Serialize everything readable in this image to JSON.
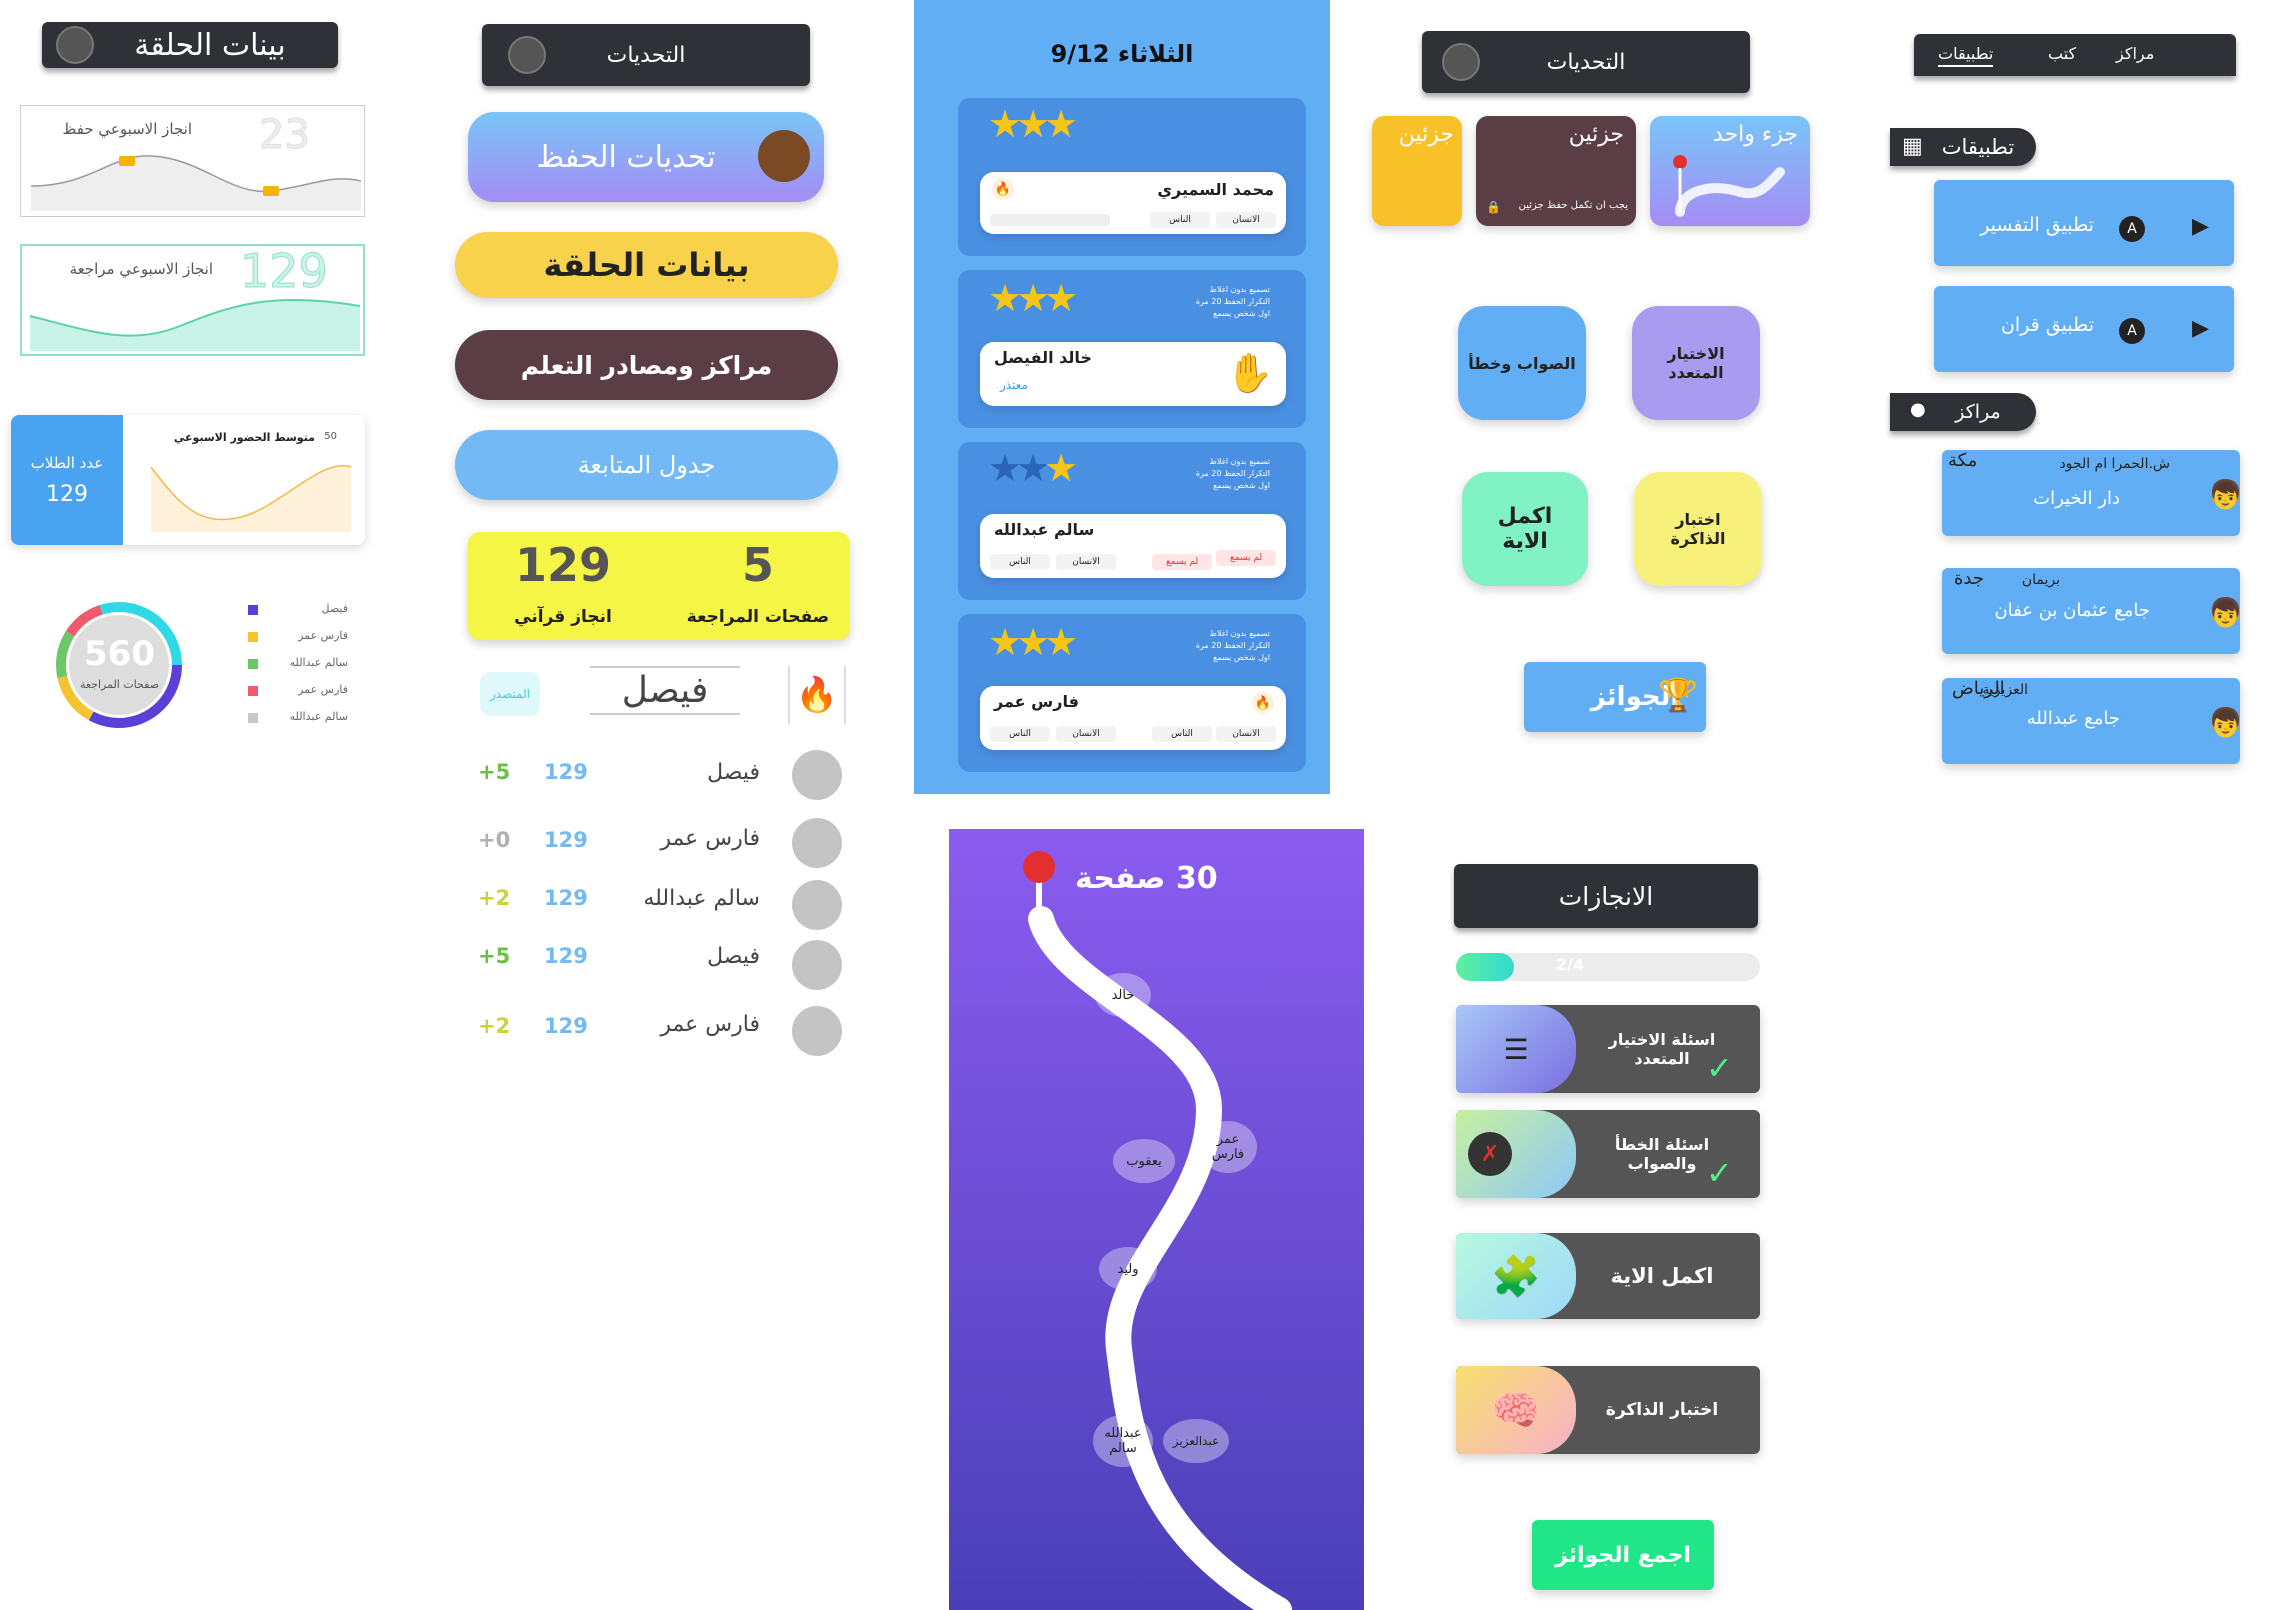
{
  "col1": {
    "title": "بينات الحلقة",
    "weekly_memo_label": "انجاز الاسبوعي حفظ",
    "weekly_memo_value": "23",
    "weekly_review_label": "انجاز الاسبوعي مراجعة",
    "weekly_review_value": "129",
    "attendance_title": "متوسط الحضور الاسبوعي",
    "attendance_max": "50",
    "students_label": "عدد الطلاب",
    "students_value": "129",
    "donut_value": "560",
    "donut_label": "صفحات المراجعة",
    "legend": [
      {
        "name": "فيصل",
        "color": "#5b3fd6"
      },
      {
        "name": "فارس عمر",
        "color": "#f4c430"
      },
      {
        "name": "سالم عبدالله",
        "color": "#6cc76a"
      },
      {
        "name": "فارس عمر",
        "color": "#f05a6e"
      },
      {
        "name": "سالم عبدالله",
        "color": "#c8c8c8"
      }
    ]
  },
  "col2": {
    "header": "التحديات",
    "btn_memo_challenges": "تحديات الحفظ",
    "btn_circle_data": "بيانات الحلقة",
    "btn_centers": "مراكز ومصادر التعلم",
    "btn_schedule": "جدول المتابعة",
    "stats": {
      "review_value": "5",
      "review_label": "صفحات المراجعة",
      "quran_value": "129",
      "quran_label": "انجاز قرآني"
    },
    "leader_badge": "المتصدر",
    "leader_name": "فيصل",
    "rows": [
      {
        "name": "فيصل",
        "score": "129",
        "delta": "+5",
        "delta_color": "#6cc04a"
      },
      {
        "name": "فارس عمر",
        "score": "129",
        "delta": "+0",
        "delta_color": "#b0b0b0"
      },
      {
        "name": "سالم عبدالله",
        "score": "129",
        "delta": "+2",
        "delta_color": "#c7d43a"
      },
      {
        "name": "فيصل",
        "score": "129",
        "delta": "+5",
        "delta_color": "#6cc04a"
      },
      {
        "name": "فارس عمر",
        "score": "129",
        "delta": "+2",
        "delta_color": "#c7d43a"
      }
    ]
  },
  "col3": {
    "date": "الثلاثاء 9/12",
    "cards": [
      {
        "name": "محمد السميري",
        "tags": [
          "الانسان",
          "الناس"
        ],
        "notes": []
      },
      {
        "name": "خالد الفيصل",
        "status": "معتذر",
        "notes": [
          "تسميع بدون اغلاط",
          "التكرار الحفظ 20 مرة",
          "اول شخص يسمع"
        ]
      },
      {
        "name": "سالم عبدالله",
        "tags": [
          "الناس",
          "الانسان"
        ],
        "warn": "لم يسمع",
        "warn2": "لم يسمع",
        "notes": [
          "تسميع بدون اغلاط",
          "التكرار الحفظ 20 مرة",
          "اول شخص يسمع"
        ]
      },
      {
        "name": "فارس عمر",
        "tags": [
          "الناس",
          "الانسان",
          "الناس",
          "الانسان"
        ],
        "notes": [
          "تسميع بدون اغلاط",
          "التكرار الحفظ 20 مرة",
          "اول شخص يسمع"
        ]
      }
    ],
    "path_title": "30 صفحة",
    "path_names": [
      "خالد",
      "عمر فارس",
      "يعقوب",
      "وليد",
      "عبدالله سالم",
      "عبدالعزيز"
    ]
  },
  "col4": {
    "header": "التحديات",
    "tile_one": "جزء واحد",
    "tile_two": "جزئين",
    "tile_two_note": "يجب ان تكمل حفظ جزئين",
    "tile_two_b": "جزئين",
    "mcq": "الاختيار المتعدد",
    "tf": "الصواب وخطأ",
    "memory": "اختبار الذاكرة",
    "complete": "اكمل الاية",
    "prizes": "الجوائز",
    "achievements_header": "الانجازات",
    "progress_text": "2/4",
    "progress_fraction": 0.5,
    "ach": [
      {
        "label": "اسئلة الاختيار المتعدد",
        "done": true
      },
      {
        "label": "اسئلة الخطأ والصواب",
        "done": true
      },
      {
        "label": "اكمل الاية",
        "done": false
      },
      {
        "label": "اختبار الذاكرة",
        "done": false
      }
    ],
    "collect": "اجمع الجوائز"
  },
  "col5": {
    "tabs": [
      "مراكز",
      "كتب",
      "تطبيقات"
    ],
    "apps_header": "تطبيقات",
    "apps": [
      "تطبيق التفسير",
      "تطبيق قران"
    ],
    "centers_header": "مراكز",
    "centers": [
      {
        "city": "مكة",
        "district": "ش.الحمرا ام الجود",
        "name": "دار الخيرات"
      },
      {
        "city": "جدة",
        "district": "بريمان",
        "name": "جامع عثمان بن عفان"
      },
      {
        "city": "الرياض",
        "district": "العزيزية",
        "name": "جامع عبدالله"
      }
    ]
  }
}
